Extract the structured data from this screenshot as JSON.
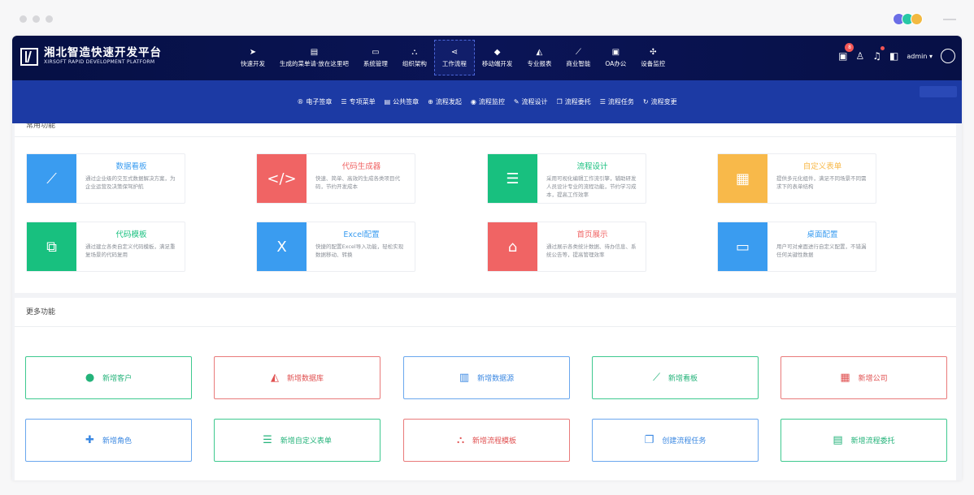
{
  "colors": {
    "nav_bg": "#061044",
    "subnav_bg": "#1c3aa4",
    "blue": "#3a9cf0",
    "red": "#f06464",
    "green": "#18c07f",
    "orange": "#f8b94a",
    "brand_dots": [
      "#6b6ee6",
      "#28c8a6",
      "#f2b941"
    ]
  },
  "header": {
    "logo_title": "湘北智造快速开发平台",
    "logo_subtitle": "XIRSOFT RAPID DEVELOPMENT PLATFORM",
    "menu": [
      {
        "label": "快速开发",
        "icon": "paper-plane-icon",
        "glyph": "➤"
      },
      {
        "label": "生成的菜单请·放在这里吧",
        "icon": "id-card-icon",
        "glyph": "▤"
      },
      {
        "label": "系统管理",
        "icon": "monitor-icon",
        "glyph": "▭"
      },
      {
        "label": "组织架构",
        "icon": "sitemap-icon",
        "glyph": "⛬"
      },
      {
        "label": "工作流程",
        "icon": "share-icon",
        "glyph": "⋖"
      },
      {
        "label": "移动端开发",
        "icon": "cube-icon",
        "glyph": "◆"
      },
      {
        "label": "专业报表",
        "icon": "area-chart-icon",
        "glyph": "◭"
      },
      {
        "label": "商业智能",
        "icon": "line-chart-icon",
        "glyph": "⟋"
      },
      {
        "label": "OA办公",
        "icon": "file-icon",
        "glyph": "▣"
      },
      {
        "label": "设备监控",
        "icon": "gamepad-icon",
        "glyph": "✣"
      }
    ],
    "active_menu": "工作流程",
    "notification_count": "8",
    "user": "admin",
    "user_caret": "▾"
  },
  "subnav": [
    {
      "label": "电子签章",
      "icon": "registered-icon",
      "glyph": "®"
    },
    {
      "label": "专项菜单",
      "icon": "list-icon",
      "glyph": "☰"
    },
    {
      "label": "公共签章",
      "icon": "calendar-icon",
      "glyph": "▤"
    },
    {
      "label": "流程发起",
      "icon": "plus-circle-icon",
      "glyph": "⊕"
    },
    {
      "label": "流程监控",
      "icon": "eye-icon",
      "glyph": "◉"
    },
    {
      "label": "流程设计",
      "icon": "edit-icon",
      "glyph": "✎"
    },
    {
      "label": "流程委托",
      "icon": "copy-icon",
      "glyph": "❐"
    },
    {
      "label": "流程任务",
      "icon": "list-alt-icon",
      "glyph": "☰"
    },
    {
      "label": "流程变更",
      "icon": "refresh-icon",
      "glyph": "↻"
    }
  ],
  "common": {
    "title": "常用功能",
    "cards": [
      {
        "title": "数据看板",
        "desc": "通过企业级的交互式数据解决方案，为企业运营及决策保驾护航",
        "color": "#3a9cf0",
        "icon": "line-chart-icon",
        "glyph": "⟋"
      },
      {
        "title": "代码生成器",
        "desc": "快速、简单、高效的生成各类项目代码，节约开发成本",
        "color": "#f06464",
        "icon": "code-icon",
        "glyph": "</>"
      },
      {
        "title": "流程设计",
        "desc": "采用可视化编辑工作流引擎，辅助研发人员设计专业的流程功能，节约学习成本，提高工作效率",
        "color": "#18c07f",
        "icon": "sliders-icon",
        "glyph": "☰"
      },
      {
        "title": "自定义表单",
        "desc": "提供多元化组件，满足不同场景不同需求下的表单结构",
        "color": "#f8b94a",
        "icon": "form-icon",
        "glyph": "▦"
      },
      {
        "title": "代码模板",
        "desc": "通过建立各类自定义代码模板，满足重复场景的代码复用",
        "color": "#18c07f",
        "icon": "clone-icon",
        "glyph": "⧉"
      },
      {
        "title": "Excel配置",
        "desc": "快捷的配置Excel导入功能，轻松实现数据移动、转换",
        "color": "#3a9cf0",
        "icon": "excel-icon",
        "glyph": "X"
      },
      {
        "title": "首页展示",
        "desc": "通过展示各类统计数据、待办信息、系统公告等，提高管理效率",
        "color": "#f06464",
        "icon": "home-icon",
        "glyph": "⌂"
      },
      {
        "title": "桌面配置",
        "desc": "用户可对桌面进行自定义配置，不错漏任何关键性数据",
        "color": "#3a9cf0",
        "icon": "desktop-icon",
        "glyph": "▭"
      }
    ]
  },
  "more": {
    "title": "更多功能",
    "buttons": [
      {
        "label": "新增客户",
        "icon": "user-icon",
        "glyph": "●",
        "style": "green"
      },
      {
        "label": "新增数据库",
        "icon": "area-chart-icon",
        "glyph": "◭",
        "style": "red"
      },
      {
        "label": "新增数据源",
        "icon": "bar-chart-icon",
        "glyph": "▥",
        "style": "blue"
      },
      {
        "label": "新增看板",
        "icon": "line-chart-icon",
        "glyph": "⟋",
        "style": "green"
      },
      {
        "label": "新增公司",
        "icon": "building-icon",
        "glyph": "▦",
        "style": "red"
      },
      {
        "label": "新增角色",
        "icon": "user-plus-icon",
        "glyph": "✚",
        "style": "blue"
      },
      {
        "label": "新增自定义表单",
        "icon": "th-list-icon",
        "glyph": "☰",
        "style": "green"
      },
      {
        "label": "新增流程模板",
        "icon": "sitemap-icon",
        "glyph": "⛬",
        "style": "red"
      },
      {
        "label": "创建流程任务",
        "icon": "copy-icon",
        "glyph": "❐",
        "style": "blue"
      },
      {
        "label": "新增流程委托",
        "icon": "file-text-icon",
        "glyph": "▤",
        "style": "green"
      }
    ]
  }
}
